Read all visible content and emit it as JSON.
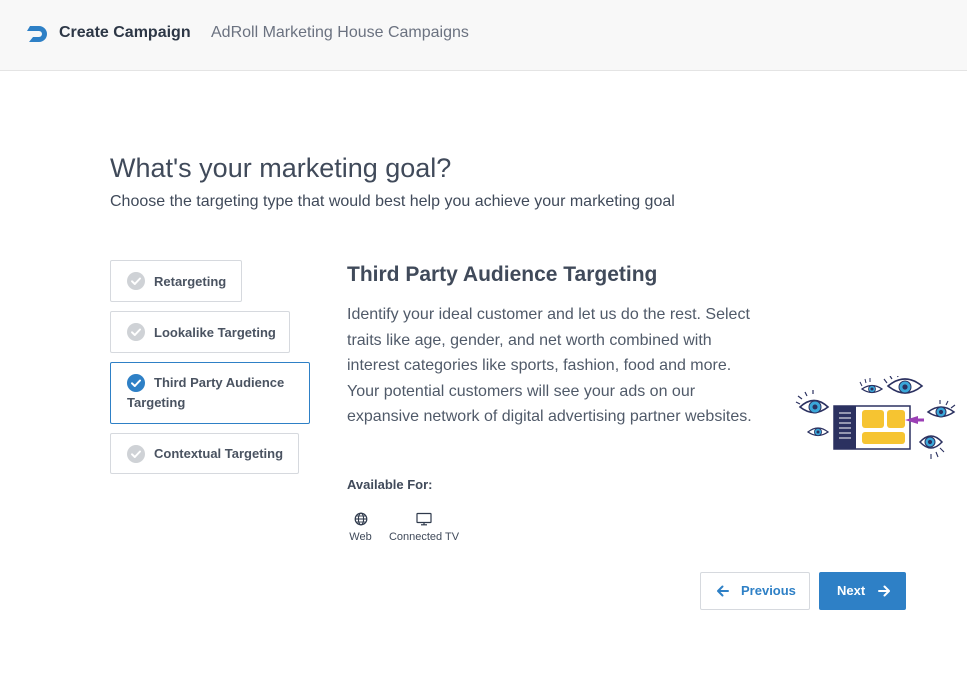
{
  "header": {
    "title": "Create Campaign",
    "subtitle": "AdRoll Marketing House Campaigns",
    "logo_color": "#2e80c6"
  },
  "main": {
    "title": "What's your marketing goal?",
    "subtitle": "Choose the targeting type that would best help you achieve your marketing goal"
  },
  "options": [
    {
      "label": "Retargeting",
      "selected": false
    },
    {
      "label": "Lookalike Targeting",
      "selected": false
    },
    {
      "label": "Third Party Audience Targeting",
      "selected": true
    },
    {
      "label": "Contextual Targeting",
      "selected": false
    }
  ],
  "detail": {
    "title": "Third Party Audience Targeting",
    "body": "Identify your ideal customer and let us do the rest. Select traits like age, gender, and net worth combined with interest categories like sports, fashion, food and more. Your potential customers will see your ads on our expansive network of digital advertising partner websites.",
    "available_label": "Available For:",
    "platforms": [
      {
        "label": "Web",
        "icon": "globe-icon"
      },
      {
        "label": "Connected TV",
        "icon": "tv-icon"
      }
    ]
  },
  "buttons": {
    "previous": "Previous",
    "next": "Next"
  },
  "colors": {
    "accent": "#2e80c6",
    "check_inactive": "#cfd2d6",
    "illustration_yellow": "#f6c431",
    "illustration_navy": "#2b3160",
    "illustration_purple": "#9b3fb5"
  }
}
